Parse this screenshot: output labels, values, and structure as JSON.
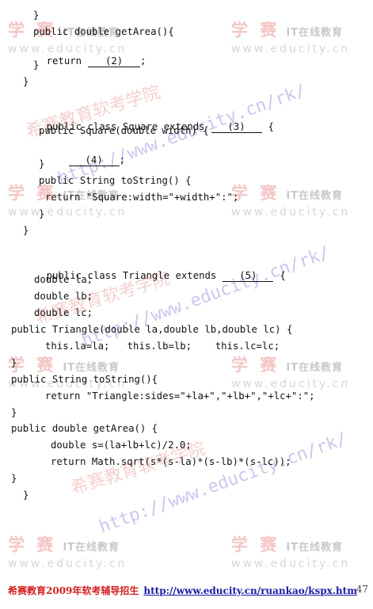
{
  "watermark": {
    "logo_cn": "学 赛",
    "logo_en": "IT在线教育",
    "url": "www.educity.cn",
    "diag_cn": "希赛教育软考学院",
    "diag_url": "http://www.educity.cn/rk/"
  },
  "code": {
    "l1": "}",
    "l2": "public double getArea(){",
    "l3_pre": "return",
    "l3_blank": "(2)",
    "l3_post": ";",
    "l4": "}",
    "l5": "}",
    "l6_pre": "public class Square extends",
    "l6_blank": "(3)",
    "l6_post": "{",
    "l7": "public Square(double width) {",
    "l8_blank": "(4)",
    "l8_post": ";",
    "l9": "}",
    "l10": "public String toString() {",
    "l11": "return \"Square:width=\"+width+\":\";",
    "l12": "}",
    "l13": "}",
    "l14_pre": "public class Triangle extends",
    "l14_blank": "(5)",
    "l14_post": "{",
    "l15": "double la;",
    "l16": "double lb;",
    "l17": "double lc;",
    "l18": "public Triangle(double la,double lb,double lc) {",
    "l19": "this.la=la;   this.lb=lb;    this.lc=lc;",
    "l20": "}",
    "l21": "public String toString(){",
    "l22": "return \"Triangle:sides=\"+la+\",\"+lb+\",\"+lc+\":\";",
    "l23": "}",
    "l24": "public double getArea() {",
    "l25": "double s=(la+lb+lc)/2.0;",
    "l26": "return Math.sqrt(s*(s-la)*(s-lb)*(s-lc));",
    "l27": "}",
    "l28": "}"
  },
  "footer": {
    "left": "希赛教育2009年软考辅导招生",
    "link": "http://www.educity.cn/ruankao/kspx.htm",
    "page": "47"
  }
}
